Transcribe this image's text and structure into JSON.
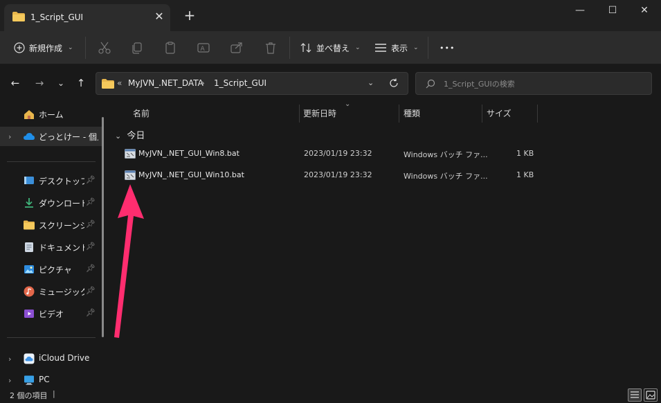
{
  "window": {
    "tab_title": "1_Script_GUI",
    "new_tab": "+",
    "minimize": "—",
    "maximize": "☐",
    "close": "✕"
  },
  "toolbar": {
    "new_label": "新規作成",
    "sort_label": "並べ替え",
    "view_label": "表示",
    "more": "•••"
  },
  "address": {
    "prefix": "«",
    "crumbs": [
      "MyJVN_.NET_DATA",
      "1_Script_GUI"
    ],
    "separator": "›"
  },
  "search": {
    "placeholder": "1_Script_GUIの検索"
  },
  "sidebar": {
    "items": [
      {
        "label": "ホーム"
      },
      {
        "label": "どっとけー - 個人用"
      },
      {
        "label": "デスクトップ"
      },
      {
        "label": "ダウンロード"
      },
      {
        "label": "スクリーンショット"
      },
      {
        "label": "ドキュメント"
      },
      {
        "label": "ピクチャ"
      },
      {
        "label": "ミュージック"
      },
      {
        "label": "ビデオ"
      },
      {
        "label": "iCloud Drive"
      },
      {
        "label": "PC"
      }
    ]
  },
  "columns": {
    "name": "名前",
    "date": "更新日時",
    "type": "種類",
    "size": "サイズ"
  },
  "group": {
    "label": "今日"
  },
  "files": [
    {
      "name": "MyJVN_.NET_GUI_Win8.bat",
      "date": "2023/01/19 23:32",
      "type": "Windows バッチ ファ...",
      "size": "1 KB"
    },
    {
      "name": "MyJVN_.NET_GUI_Win10.bat",
      "date": "2023/01/19 23:32",
      "type": "Windows バッチ ファ...",
      "size": "1 KB"
    }
  ],
  "status": {
    "count": "2 個の項目"
  },
  "colors": {
    "accent_arrow": "#ff2d6f",
    "folder": "#e8b64c",
    "background": "#191919"
  }
}
